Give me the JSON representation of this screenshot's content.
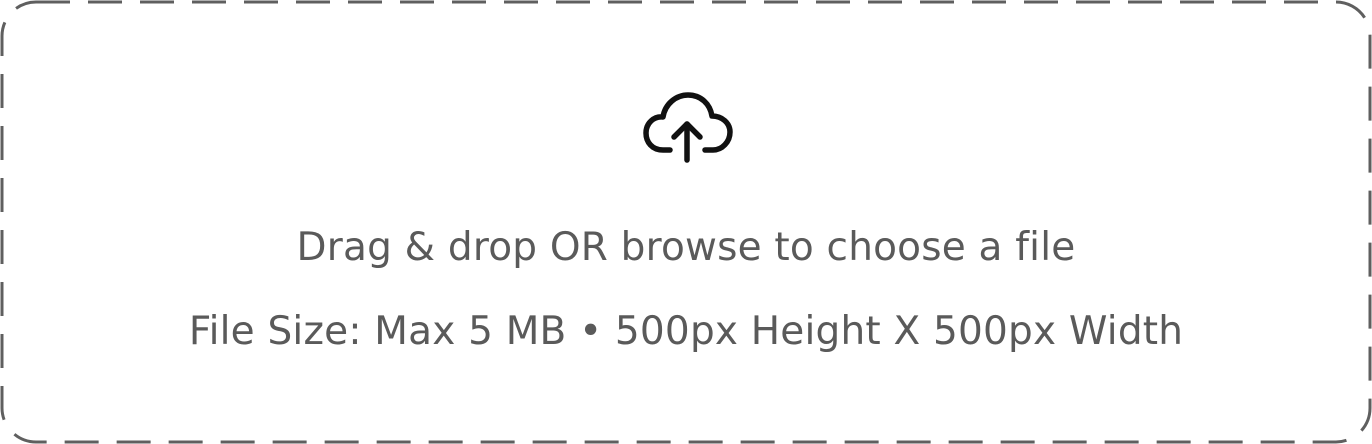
{
  "upload": {
    "icon": "cloud-upload-icon",
    "prompt": "Drag & drop OR browse to choose a file",
    "requirements": "File Size: Max 5 MB • 500px Height X 500px Width",
    "border_color": "#5f5f5f",
    "text_color": "#5a5a5a"
  }
}
